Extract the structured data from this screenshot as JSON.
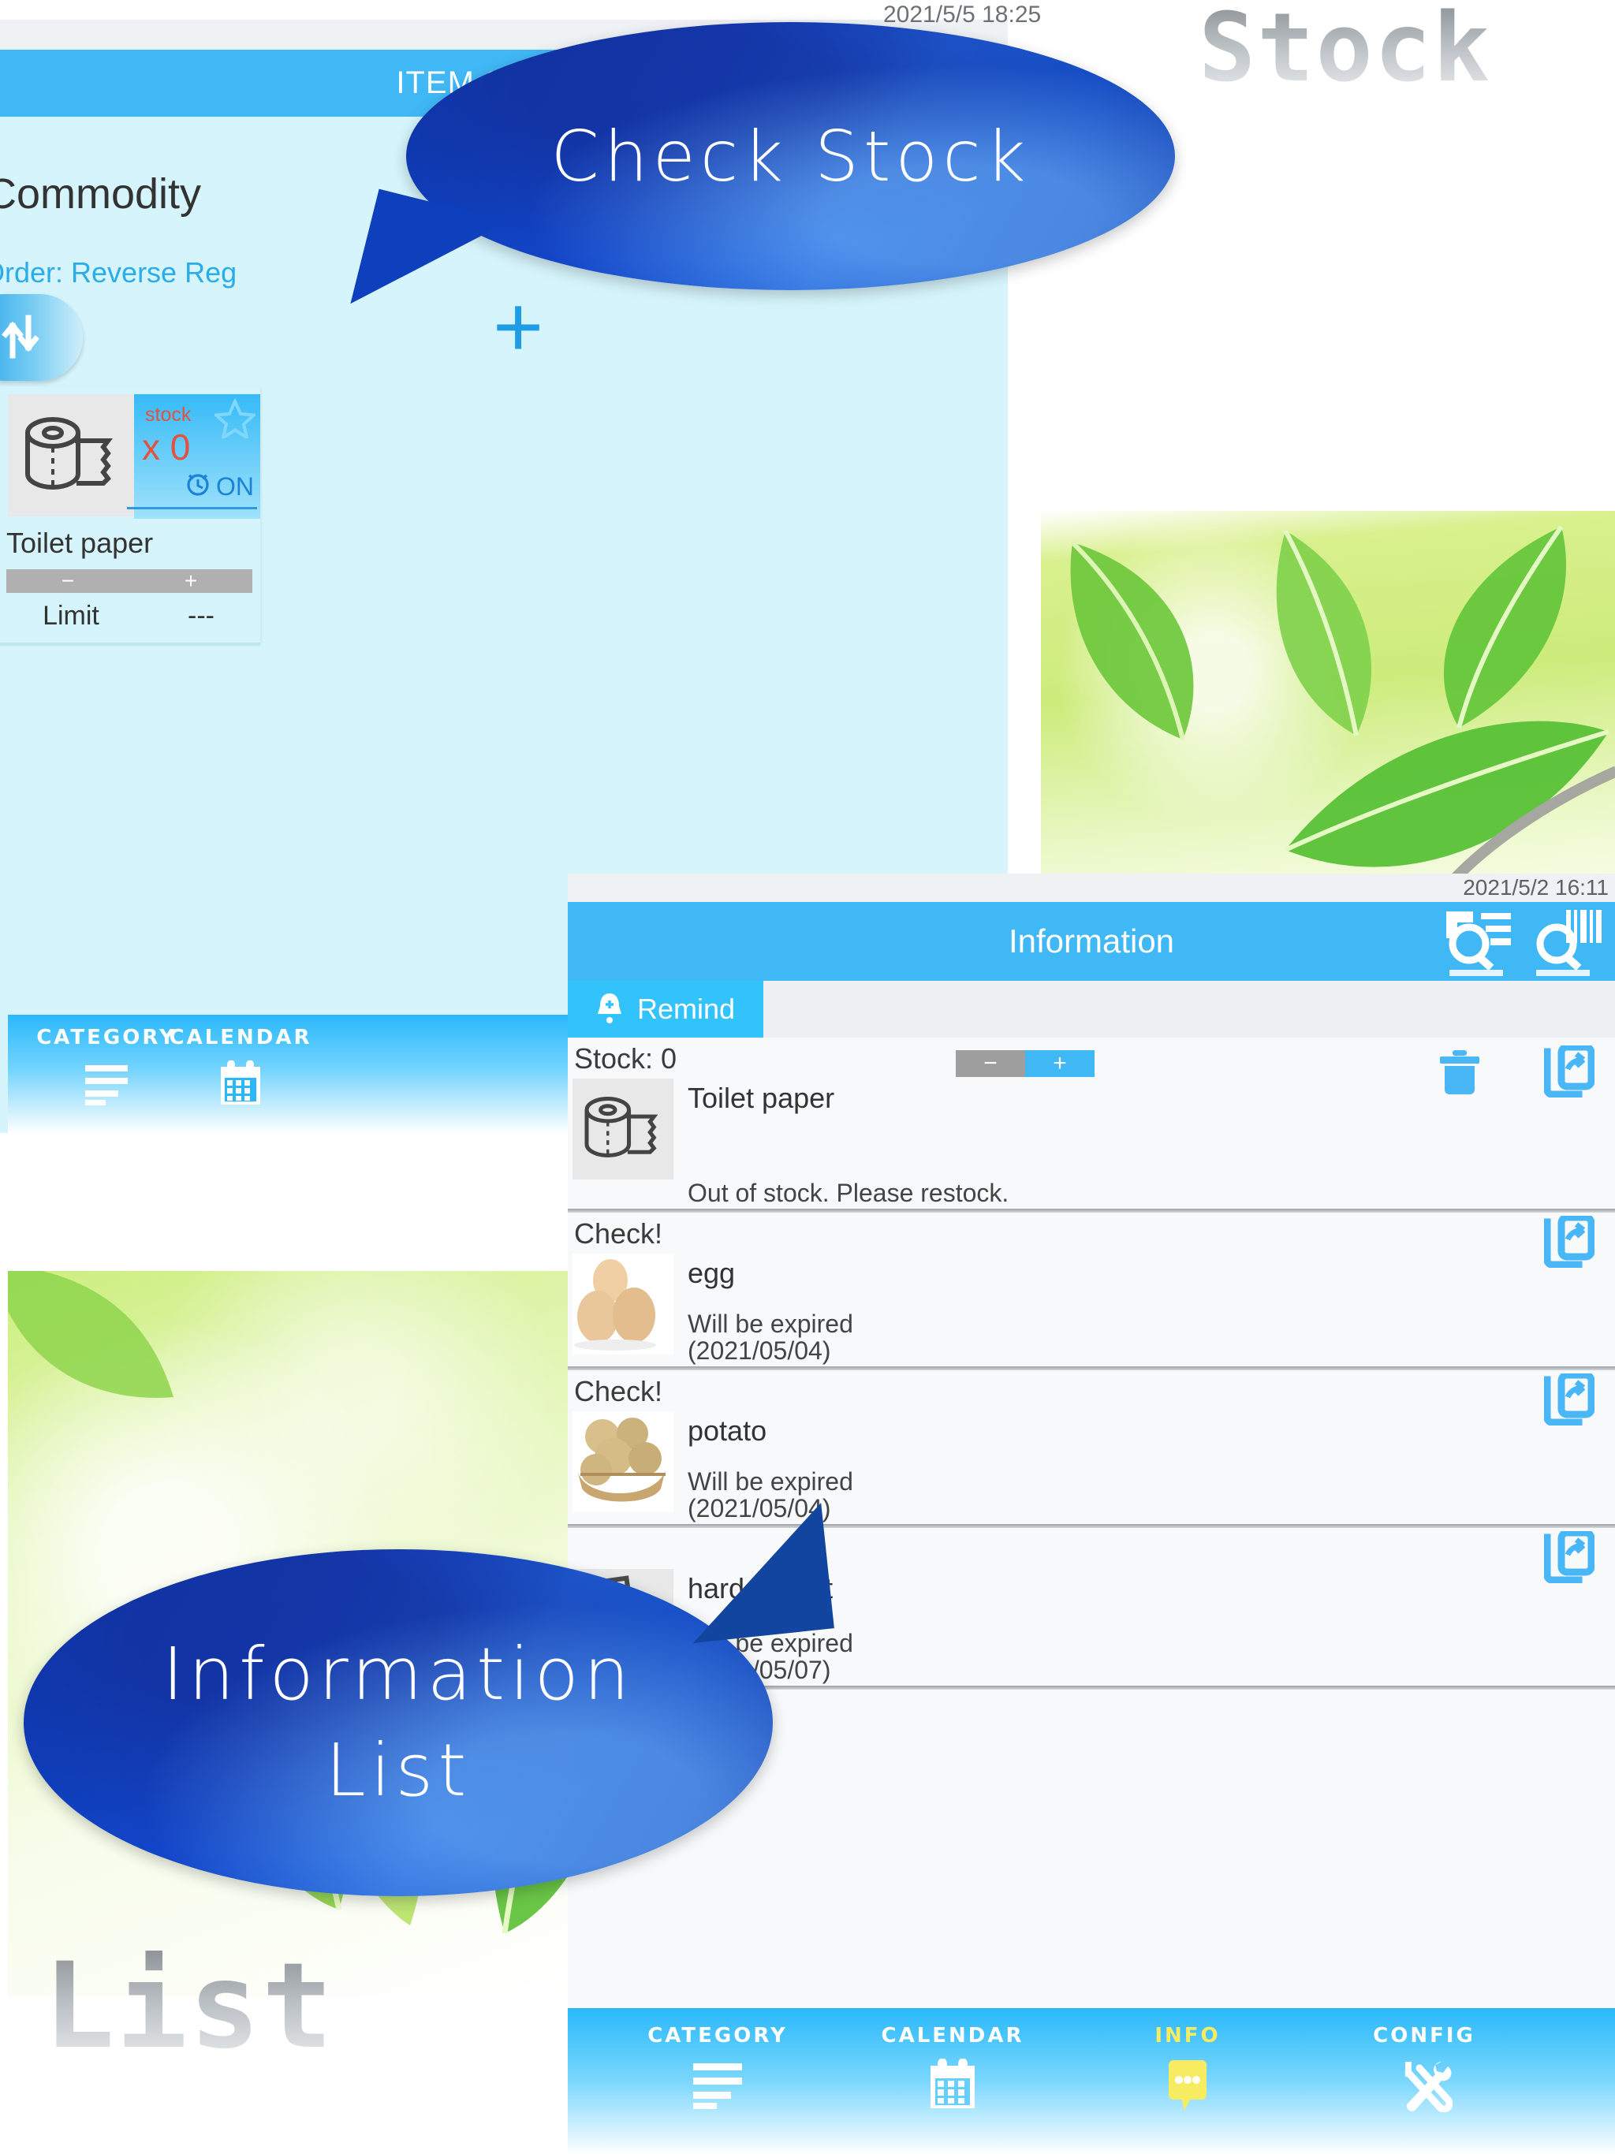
{
  "overlay": {
    "brand_top": "Stock",
    "brand_bottom": "List",
    "bubble_check": "Check Stock",
    "bubble_list_line1": "Information",
    "bubble_list_line2": "List"
  },
  "left_screen": {
    "status_time": "2021/5/5 18:25",
    "appbar_title": "ITEM SELECT",
    "search_icon": "document-search-icon",
    "section_title": "Commodity",
    "order_label": "Order: Reverse Reg",
    "sort_icon": "sort-updown-icon",
    "add_label": "+",
    "item": {
      "thumb_icon": "toilet-paper-icon",
      "stock_word": "stock",
      "stock_count": "x 0",
      "star_icon": "star-outline-icon",
      "alarm_icon": "alarm-clock-icon",
      "alarm_state": "ON",
      "name": "Toilet paper",
      "minus": "−",
      "plus": "+",
      "limit_label": "Limit",
      "limit_value": "---"
    },
    "nav": [
      {
        "label": "CATEGORY",
        "icon": "list-lines-icon",
        "active": false
      },
      {
        "label": "CALENDAR",
        "icon": "calendar-icon",
        "active": false
      }
    ]
  },
  "right_screen": {
    "status_time": "2021/5/2 16:11",
    "appbar_title": "Information",
    "icons": [
      {
        "name": "document-search-icon"
      },
      {
        "name": "barcode-search-icon"
      }
    ],
    "tab": {
      "label": "Remind",
      "icon": "bell-plus-icon"
    },
    "rows": [
      {
        "tag": "Stock: 0",
        "thumb_icon": "toilet-paper-icon",
        "name": "Toilet paper",
        "message": "Out of stock. Please restock.",
        "stepper": {
          "minus": "−",
          "plus": "+"
        },
        "actions": [
          "trash-icon",
          "share-card-icon"
        ]
      },
      {
        "tag": "Check!",
        "thumb_icon": "eggs-photo",
        "name": "egg",
        "message": "Will be expired\n(2021/05/04)",
        "actions": [
          "share-card-icon"
        ]
      },
      {
        "tag": "Check!",
        "thumb_icon": "potato-photo",
        "name": "potato",
        "message": "Will be expired\n(2021/05/04)",
        "actions": [
          "share-card-icon"
        ]
      },
      {
        "tag": "",
        "thumb_icon": "hard-biscuit-icon",
        "name": "hard biscuit",
        "message": "Will be expired\n(2021/05/07)",
        "actions": [
          "share-card-icon"
        ]
      }
    ],
    "nav": [
      {
        "label": "CATEGORY",
        "icon": "list-lines-icon",
        "active": false
      },
      {
        "label": "CALENDAR",
        "icon": "calendar-icon",
        "active": false
      },
      {
        "label": "INFO",
        "icon": "speech-bubble-icon",
        "active": true
      },
      {
        "label": "CONFIG",
        "icon": "wrench-screwdriver-icon",
        "active": false
      }
    ]
  },
  "colors": {
    "accent_blue": "#40b8f5",
    "appbar_blue": "#40b8f5",
    "bubble_blue": "#123fb9",
    "active_yellow": "#f7eb61",
    "stock_red": "#e2523f",
    "left_bg": "#d5f4fb"
  }
}
